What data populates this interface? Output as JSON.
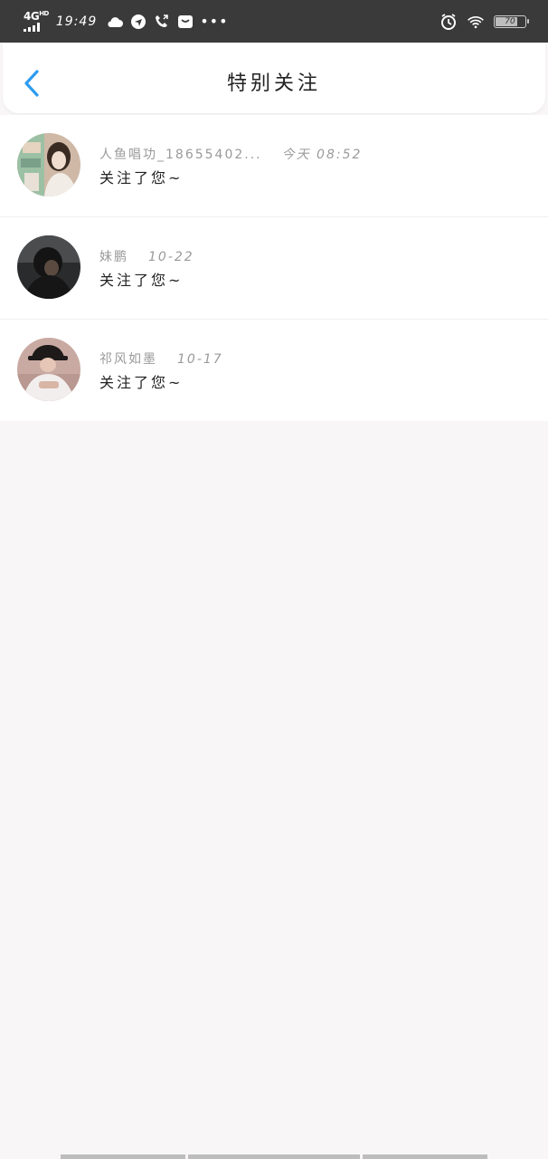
{
  "status_bar": {
    "network": "4G",
    "network_sup": "HD",
    "time": "19:49",
    "battery": "70"
  },
  "header": {
    "title": "特别关注"
  },
  "items": [
    {
      "name": "人鱼唱功_18655402...",
      "time": "今天 08:52",
      "message": "关注了您~"
    },
    {
      "name": "妹鹏",
      "time": "10-22",
      "message": "关注了您~"
    },
    {
      "name": "祁风如墨",
      "time": "10-17",
      "message": "关注了您~"
    }
  ],
  "colors": {
    "accent": "#2d9cf0",
    "status_bar_bg": "#3a3a3a",
    "page_bg": "#f8f6f7"
  }
}
